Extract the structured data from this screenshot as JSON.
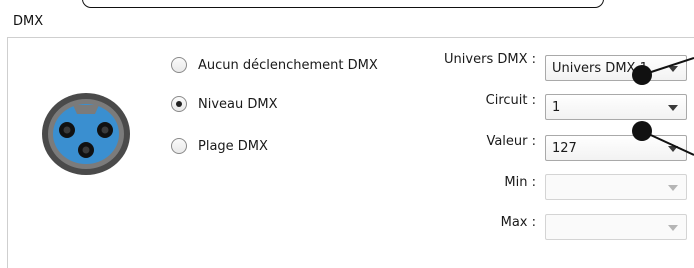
{
  "group": {
    "title": "DMX"
  },
  "trigger": {
    "options": [
      {
        "label": "Aucun déclenchement DMX",
        "selected": false
      },
      {
        "label": "Niveau DMX",
        "selected": true
      },
      {
        "label": "Plage DMX",
        "selected": false
      }
    ]
  },
  "fields": {
    "universe": {
      "label": "Univers DMX :",
      "value": "Univers DMX 1"
    },
    "circuit": {
      "label": "Circuit :",
      "value": "1"
    },
    "value": {
      "label": "Valeur :",
      "value": "127"
    },
    "min": {
      "label": "Min :",
      "value": ""
    },
    "max": {
      "label": "Max :",
      "value": ""
    }
  },
  "icons": {
    "connector": "xlr-connector-icon"
  },
  "colors": {
    "connector_face": "#3a8fd0",
    "connector_ring": "#4a4a4a",
    "annotation": "#111111"
  }
}
